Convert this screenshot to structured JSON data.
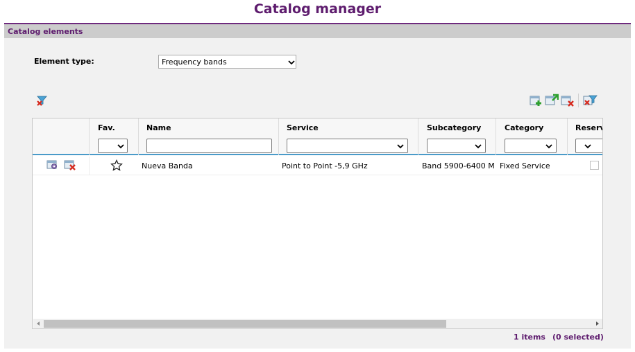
{
  "page": {
    "title": "Catalog manager"
  },
  "panel": {
    "title": "Catalog elements"
  },
  "form": {
    "element_type_label": "Element type:",
    "element_type_value": "Frequency bands"
  },
  "grid": {
    "columns": {
      "fav": "Fav.",
      "name": "Name",
      "service": "Service",
      "subcategory": "Subcategory",
      "category": "Category",
      "reserved": "Reserv"
    },
    "rows": [
      {
        "favorite": false,
        "name": "Nueva Banda",
        "service": "Point to Point -5,9 GHz",
        "subcategory": "Band 5900-6400 M",
        "category": "Fixed Service",
        "reserved": false
      }
    ]
  },
  "status": {
    "items": "1 items",
    "selected": "(0 selected)"
  },
  "colors": {
    "accent": "#5e1c6e",
    "header_bg": "#cccccc",
    "panel_bg": "#f1f1f1",
    "grid_line": "#4a9bc9"
  }
}
